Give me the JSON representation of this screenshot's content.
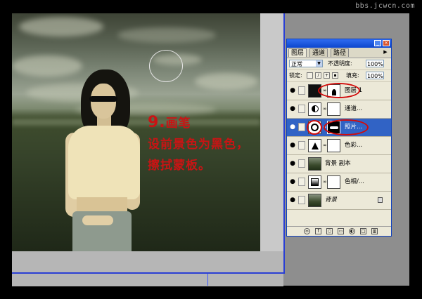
{
  "watermark": "bbs.jcwcn.com",
  "annotation": {
    "step_number": "9.",
    "step_title": "画笔",
    "line2": "设前景色为黑色，",
    "line3": "擦拭蒙板。"
  },
  "layers_panel": {
    "tabs": [
      {
        "label": "图层",
        "active": true
      },
      {
        "label": "通道",
        "active": false
      },
      {
        "label": "路径",
        "active": false
      }
    ],
    "tab_menu_icon": "triangle-right-icon",
    "blend_mode": "正常",
    "opacity_label": "不透明度:",
    "opacity_value": "100%",
    "lock_label": "锁定:",
    "fill_label": "填充:",
    "fill_value": "100%",
    "layers": [
      {
        "name": "图层 1",
        "selected": false,
        "has_mask": true,
        "has_adjustment": false
      },
      {
        "name": "通道...",
        "selected": false,
        "has_mask": true,
        "has_adjustment": true
      },
      {
        "name": "照片...",
        "selected": true,
        "has_mask": true,
        "has_adjustment": true
      },
      {
        "name": "色彩...",
        "selected": false,
        "has_mask": true,
        "has_adjustment": true
      },
      {
        "name": "背景 副本",
        "selected": false,
        "has_mask": false,
        "has_adjustment": false
      },
      {
        "name": "色相/...",
        "selected": false,
        "has_mask": true,
        "has_adjustment": true
      },
      {
        "name": "背景",
        "selected": false,
        "has_mask": false,
        "has_adjustment": false,
        "locked": true
      }
    ]
  },
  "colors": {
    "annotation_red": "#c81414",
    "selection_blue": "#3163c5",
    "title_blue": "#0c45cc",
    "highlight_ring": "#d10c0c"
  }
}
